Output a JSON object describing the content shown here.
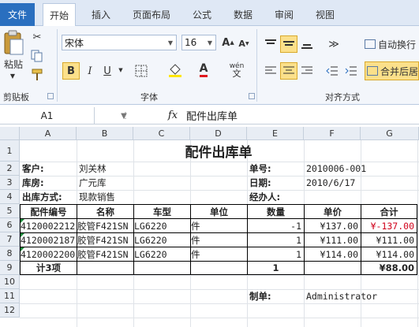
{
  "ribbon": {
    "tabs": [
      "文件",
      "开始",
      "插入",
      "页面布局",
      "公式",
      "数据",
      "审阅",
      "视图"
    ],
    "paste_label": "粘贴",
    "font_name": "宋体",
    "font_size": "16",
    "bold": "B",
    "italic": "I",
    "underline": "U",
    "wen": "wén",
    "wrap_label": "自动换行",
    "merge_label": "合并后居",
    "groups": {
      "clipboard": "剪贴板",
      "font": "字体",
      "align": "对齐方式"
    }
  },
  "formula_bar": {
    "name_box": "A1",
    "fx": "fx",
    "content": "配件出库单"
  },
  "columns": [
    "A",
    "B",
    "C",
    "D",
    "E",
    "F",
    "G"
  ],
  "rows": [
    "1",
    "2",
    "3",
    "4",
    "5",
    "6",
    "7",
    "8",
    "9",
    "10",
    "11",
    "12"
  ],
  "sheet": {
    "title": "配件出库单",
    "customer_label": "客户:",
    "customer": "刘关林",
    "doc_no_label": "单号:",
    "doc_no": "2010006-001",
    "warehouse_label": "库房:",
    "warehouse": "广元库",
    "date_label": "日期:",
    "date": "2010/6/17",
    "out_type_label": "出库方式:",
    "out_type": "现款销售",
    "handler_label": "经办人:",
    "headers": [
      "配件编号",
      "名称",
      "车型",
      "单位",
      "数量",
      "单价",
      "合计"
    ],
    "items": [
      {
        "code": "4120002212",
        "name": "胶管F421SN",
        "model": "LG6220",
        "unit": "件",
        "qty": "-1",
        "price": "¥137.00",
        "total": "¥-137.00"
      },
      {
        "code": "4120002187",
        "name": "胶管F421SN",
        "model": "LG6220",
        "unit": "件",
        "qty": "1",
        "price": "¥111.00",
        "total": "¥111.00"
      },
      {
        "code": "4120002200",
        "name": "胶管F421SN",
        "model": "LG6220",
        "unit": "件",
        "qty": "1",
        "price": "¥114.00",
        "total": "¥114.00"
      }
    ],
    "summary_label": "计3项",
    "summary_qty": "1",
    "summary_total": "¥88.00",
    "maker_label": "制单:",
    "maker": "Administrator"
  },
  "colors": {
    "file_tab": "#2a6fbf",
    "negative": "#d0021b",
    "error_triangle": "#1a8a3a"
  }
}
